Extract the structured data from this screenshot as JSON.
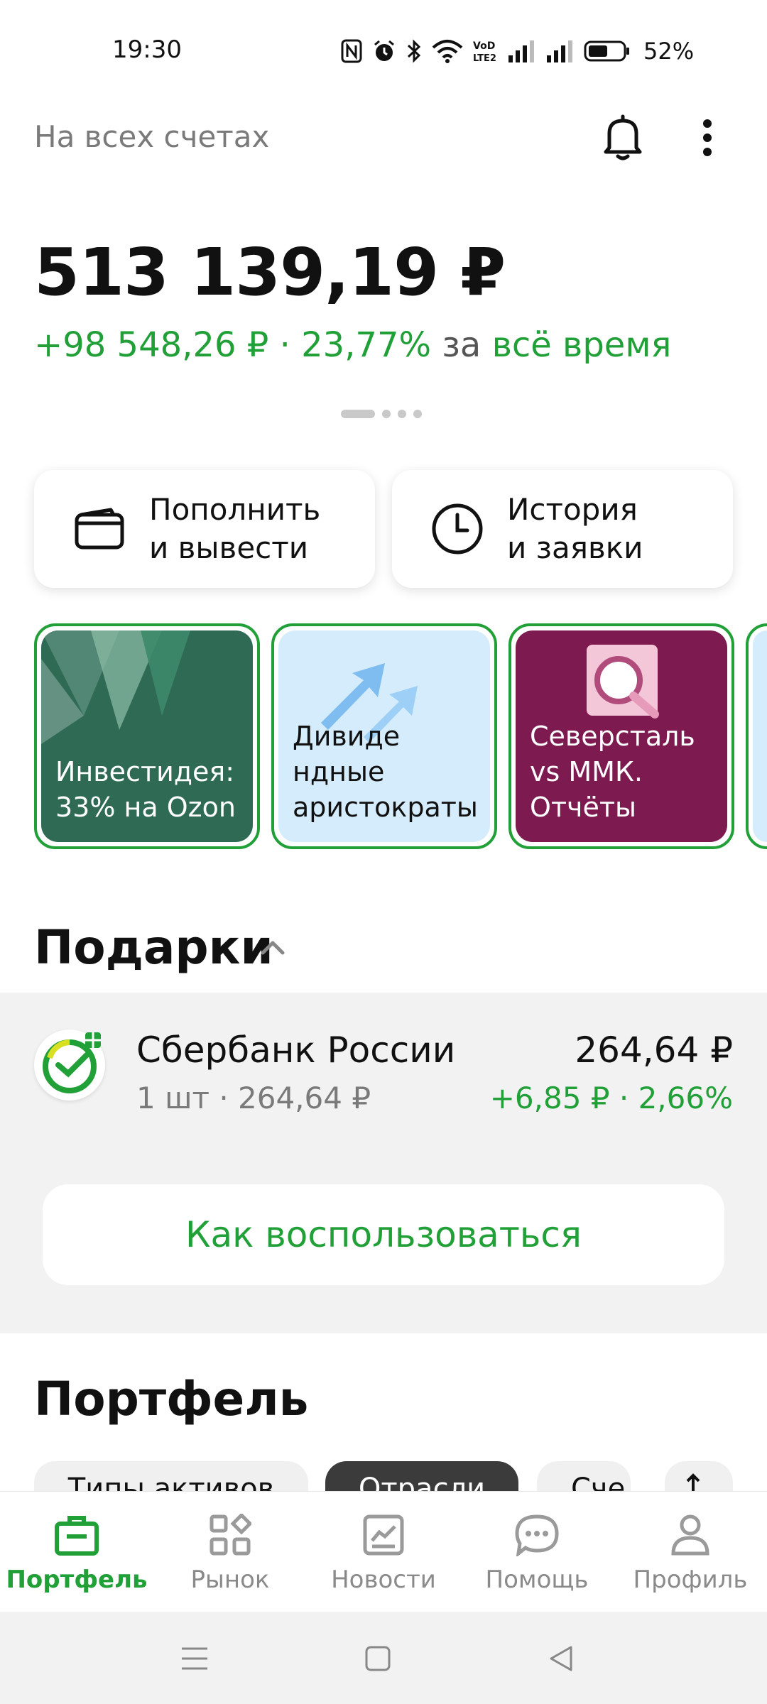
{
  "status_bar": {
    "time": "19:30",
    "battery_pct": "52%",
    "icons": [
      "nfc-icon",
      "alarm-icon",
      "bluetooth-icon",
      "wifi-icon",
      "volte-icon",
      "signal-icon",
      "signal-icon",
      "battery-icon"
    ]
  },
  "header": {
    "title": "На всех счетах"
  },
  "balance": {
    "total": "513 139,19 ₽",
    "gain_value": "+98 548,26 ₽ · 23,77%",
    "gain_prefix": "за",
    "gain_period": "всё время"
  },
  "actions": [
    {
      "label": "Пополнить\nи вывести",
      "icon": "wallet-icon"
    },
    {
      "label": "История\nи заявки",
      "icon": "clock-icon"
    }
  ],
  "stories": [
    {
      "text": "Инвестидея:\n33% на Ozon"
    },
    {
      "text": "Дивиде\nндные\nаристократы"
    },
    {
      "text": "Северсталь\nvs ММК.\nОтчёты"
    }
  ],
  "gifts": {
    "title": "Подарки",
    "item": {
      "name": "Сбербанк России",
      "qty": "1 шт · 264,64 ₽",
      "price": "264,64 ₽",
      "change": "+6,85 ₽ · 2,66%"
    },
    "howto_label": "Как воспользоваться"
  },
  "portfolio": {
    "title": "Портфель",
    "chips": [
      "Типы активов",
      "Отрасли",
      "Сче"
    ]
  },
  "bottom_nav": [
    {
      "label": "Портфель",
      "icon": "briefcase-icon",
      "active": true
    },
    {
      "label": "Рынок",
      "icon": "grid-icon",
      "active": false
    },
    {
      "label": "Новости",
      "icon": "news-chart-icon",
      "active": false
    },
    {
      "label": "Помощь",
      "icon": "chat-icon",
      "active": false
    },
    {
      "label": "Профиль",
      "icon": "person-icon",
      "active": false
    }
  ],
  "colors": {
    "accent_green": "#21a038",
    "story_green": "#2f6a55",
    "story_blue": "#d4ecfb",
    "story_purple": "#7d1a50"
  }
}
